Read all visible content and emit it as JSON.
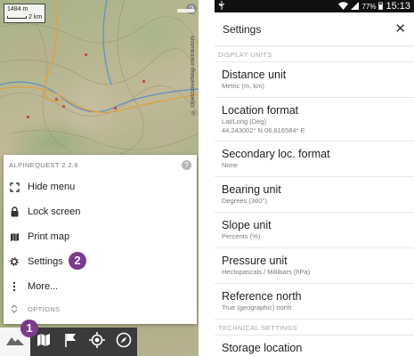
{
  "map_screen": {
    "scale": {
      "distance": "1484 m",
      "bar": "2 km"
    },
    "help_glyph": "?",
    "attribution": "© OpenStreetMap contributors",
    "menu": {
      "header": "ALPINEQUEST 2.2.6",
      "help_glyph": "?",
      "items": [
        {
          "label": "Hide menu",
          "icon": "fullscreen-icon"
        },
        {
          "label": "Lock screen",
          "icon": "lock-icon"
        },
        {
          "label": "Print map",
          "icon": "map-icon"
        },
        {
          "label": "Settings",
          "icon": "gear-icon"
        },
        {
          "label": "More...",
          "icon": "more-vertical-icon"
        }
      ],
      "options_label": "OPTIONS"
    },
    "badges": {
      "one": "1",
      "two": "2"
    },
    "toolbar": [
      "layers-icon",
      "map-icon",
      "flag-icon",
      "crosshair-icon",
      "compass-icon"
    ]
  },
  "settings_screen": {
    "status": {
      "battery": "77%",
      "time": "15:13"
    },
    "title": "Settings",
    "close_glyph": "✕",
    "sections": [
      {
        "header": "DISPLAY UNITS",
        "items": [
          {
            "name": "Distance unit",
            "value": "Metric (m, km)"
          },
          {
            "name": "Location format",
            "value": "Lat/Long (Deg)",
            "value2": "44.243002° N 06.616584° E"
          },
          {
            "name": "Secondary loc. format",
            "value": "None"
          },
          {
            "name": "Bearing unit",
            "value": "Degrees (360°)"
          },
          {
            "name": "Slope unit",
            "value": "Percents (%)"
          },
          {
            "name": "Pressure unit",
            "value": "Hectopascals / Millibars (hPa)"
          },
          {
            "name": "Reference north",
            "value": "True (geographic) north"
          }
        ]
      },
      {
        "header": "TECHNICAL SETTINGS",
        "items": [
          {
            "name": "Storage location",
            "value": ""
          }
        ]
      }
    ]
  },
  "colors": {
    "badge": "#7b3a8d",
    "toolbar": "#3a3a3a",
    "statusbar": "#111111"
  }
}
